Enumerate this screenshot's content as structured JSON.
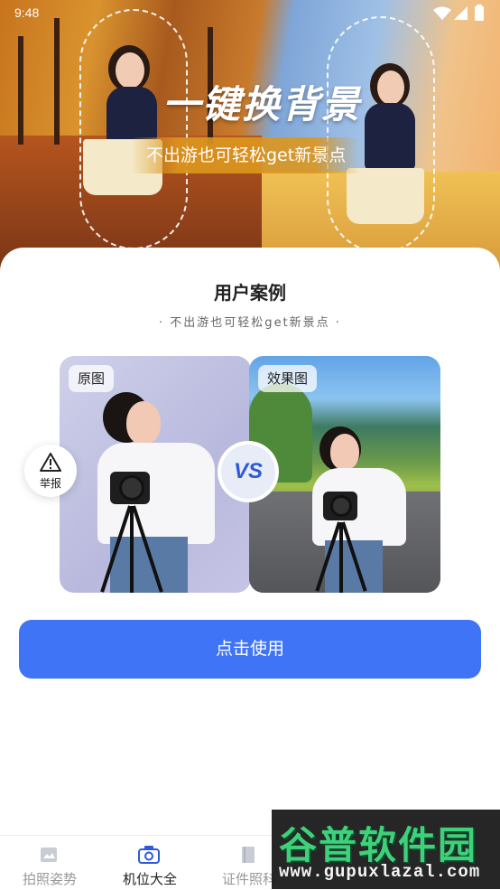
{
  "status_bar": {
    "time": "9:48"
  },
  "hero": {
    "title": "一键换背景",
    "subtitle": "不出游也可轻松get新景点"
  },
  "case": {
    "title": "用户案例",
    "subtitle": "· 不出游也可轻松get新景点 ·",
    "before_label": "原图",
    "after_label": "效果图",
    "vs_label": "VS"
  },
  "cta_label": "点击使用",
  "report_label": "举报",
  "tabs": [
    {
      "label": "拍照姿势",
      "icon": "image-icon",
      "active": false
    },
    {
      "label": "机位大全",
      "icon": "camera-icon",
      "active": true
    },
    {
      "label": "证件照科",
      "icon": "book-icon",
      "active": false
    }
  ],
  "watermark": {
    "title": "谷普软件园",
    "url": "www.gupuxlazal.com"
  },
  "colors": {
    "accent": "#3e74f5",
    "vs_text": "#2d5ad8"
  }
}
